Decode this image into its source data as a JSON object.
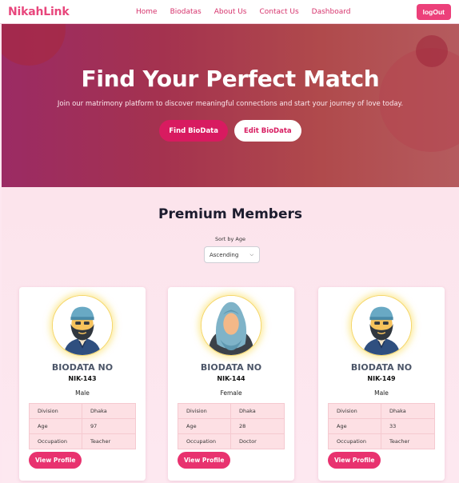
{
  "nav": {
    "logo": "NikahLink",
    "links": [
      "Home",
      "Biodatas",
      "About Us",
      "Contact Us",
      "Dashboard"
    ],
    "logout_label": "logOut"
  },
  "hero": {
    "title": "Find Your Perfect Match",
    "subtitle": "Join our matrimony platform to discover meaningful connections and start your journey of love today.",
    "find_label": "Find BioData",
    "edit_label": "Edit BioData"
  },
  "premium": {
    "title": "Premium Members",
    "sort_label": "Sort by Age",
    "sort_value": "Ascending",
    "cards": [
      {
        "avatar": "male-avatar-icon",
        "heading": "BIODATA NO",
        "nik": "NIK-143",
        "gender": "Male",
        "rows": [
          {
            "label": "Division",
            "value": "Dhaka"
          },
          {
            "label": "Age",
            "value": "97"
          },
          {
            "label": "Occupation",
            "value": "Teacher"
          }
        ],
        "view_label": "View Profile"
      },
      {
        "avatar": "female-avatar-icon",
        "heading": "BIODATA NO",
        "nik": "NIK-144",
        "gender": "Female",
        "rows": [
          {
            "label": "Division",
            "value": "Dhaka"
          },
          {
            "label": "Age",
            "value": "28"
          },
          {
            "label": "Occupation",
            "value": "Doctor"
          }
        ],
        "view_label": "View Profile"
      },
      {
        "avatar": "male-avatar-icon",
        "heading": "BIODATA NO",
        "nik": "NIK-149",
        "gender": "Male",
        "rows": [
          {
            "label": "Division",
            "value": "Dhaka"
          },
          {
            "label": "Age",
            "value": "33"
          },
          {
            "label": "Occupation",
            "value": "Teacher"
          }
        ],
        "view_label": "View Profile"
      }
    ]
  },
  "colors": {
    "brand": "#e8467c",
    "accent": "#d81b60",
    "hero_start": "#9b2b64",
    "hero_end": "#b55b5e",
    "section_bg": "#fce4ec"
  }
}
